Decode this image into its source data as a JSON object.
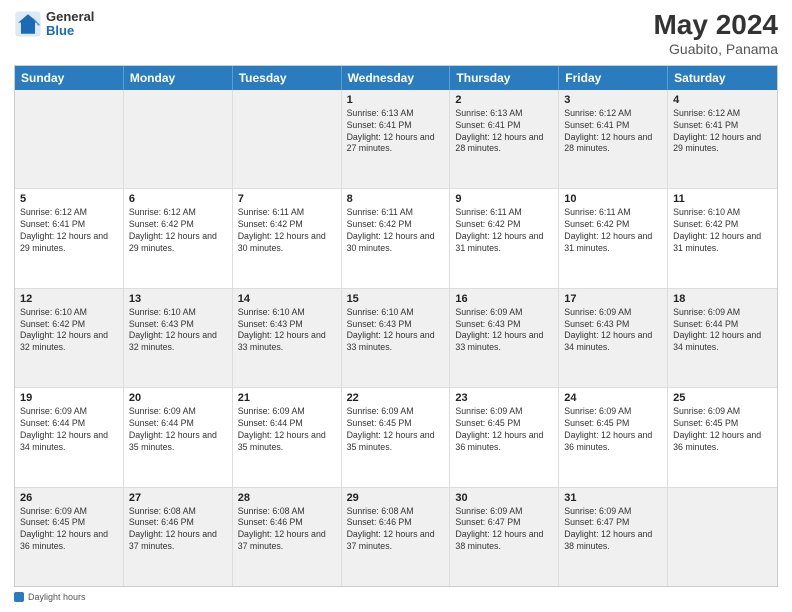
{
  "header": {
    "logo_general": "General",
    "logo_blue": "Blue",
    "title": "May 2024",
    "location": "Guabito, Panama"
  },
  "days_of_week": [
    "Sunday",
    "Monday",
    "Tuesday",
    "Wednesday",
    "Thursday",
    "Friday",
    "Saturday"
  ],
  "weeks": [
    [
      {
        "day": "",
        "empty": true
      },
      {
        "day": "",
        "empty": true
      },
      {
        "day": "",
        "empty": true
      },
      {
        "day": "1",
        "sunrise": "6:13 AM",
        "sunset": "6:41 PM",
        "daylight": "12 hours and 27 minutes."
      },
      {
        "day": "2",
        "sunrise": "6:13 AM",
        "sunset": "6:41 PM",
        "daylight": "12 hours and 28 minutes."
      },
      {
        "day": "3",
        "sunrise": "6:12 AM",
        "sunset": "6:41 PM",
        "daylight": "12 hours and 28 minutes."
      },
      {
        "day": "4",
        "sunrise": "6:12 AM",
        "sunset": "6:41 PM",
        "daylight": "12 hours and 29 minutes."
      }
    ],
    [
      {
        "day": "5",
        "sunrise": "6:12 AM",
        "sunset": "6:41 PM",
        "daylight": "12 hours and 29 minutes."
      },
      {
        "day": "6",
        "sunrise": "6:12 AM",
        "sunset": "6:42 PM",
        "daylight": "12 hours and 29 minutes."
      },
      {
        "day": "7",
        "sunrise": "6:11 AM",
        "sunset": "6:42 PM",
        "daylight": "12 hours and 30 minutes."
      },
      {
        "day": "8",
        "sunrise": "6:11 AM",
        "sunset": "6:42 PM",
        "daylight": "12 hours and 30 minutes."
      },
      {
        "day": "9",
        "sunrise": "6:11 AM",
        "sunset": "6:42 PM",
        "daylight": "12 hours and 31 minutes."
      },
      {
        "day": "10",
        "sunrise": "6:11 AM",
        "sunset": "6:42 PM",
        "daylight": "12 hours and 31 minutes."
      },
      {
        "day": "11",
        "sunrise": "6:10 AM",
        "sunset": "6:42 PM",
        "daylight": "12 hours and 31 minutes."
      }
    ],
    [
      {
        "day": "12",
        "sunrise": "6:10 AM",
        "sunset": "6:42 PM",
        "daylight": "12 hours and 32 minutes."
      },
      {
        "day": "13",
        "sunrise": "6:10 AM",
        "sunset": "6:43 PM",
        "daylight": "12 hours and 32 minutes."
      },
      {
        "day": "14",
        "sunrise": "6:10 AM",
        "sunset": "6:43 PM",
        "daylight": "12 hours and 33 minutes."
      },
      {
        "day": "15",
        "sunrise": "6:10 AM",
        "sunset": "6:43 PM",
        "daylight": "12 hours and 33 minutes."
      },
      {
        "day": "16",
        "sunrise": "6:09 AM",
        "sunset": "6:43 PM",
        "daylight": "12 hours and 33 minutes."
      },
      {
        "day": "17",
        "sunrise": "6:09 AM",
        "sunset": "6:43 PM",
        "daylight": "12 hours and 34 minutes."
      },
      {
        "day": "18",
        "sunrise": "6:09 AM",
        "sunset": "6:44 PM",
        "daylight": "12 hours and 34 minutes."
      }
    ],
    [
      {
        "day": "19",
        "sunrise": "6:09 AM",
        "sunset": "6:44 PM",
        "daylight": "12 hours and 34 minutes."
      },
      {
        "day": "20",
        "sunrise": "6:09 AM",
        "sunset": "6:44 PM",
        "daylight": "12 hours and 35 minutes."
      },
      {
        "day": "21",
        "sunrise": "6:09 AM",
        "sunset": "6:44 PM",
        "daylight": "12 hours and 35 minutes."
      },
      {
        "day": "22",
        "sunrise": "6:09 AM",
        "sunset": "6:45 PM",
        "daylight": "12 hours and 35 minutes."
      },
      {
        "day": "23",
        "sunrise": "6:09 AM",
        "sunset": "6:45 PM",
        "daylight": "12 hours and 36 minutes."
      },
      {
        "day": "24",
        "sunrise": "6:09 AM",
        "sunset": "6:45 PM",
        "daylight": "12 hours and 36 minutes."
      },
      {
        "day": "25",
        "sunrise": "6:09 AM",
        "sunset": "6:45 PM",
        "daylight": "12 hours and 36 minutes."
      }
    ],
    [
      {
        "day": "26",
        "sunrise": "6:09 AM",
        "sunset": "6:45 PM",
        "daylight": "12 hours and 36 minutes."
      },
      {
        "day": "27",
        "sunrise": "6:08 AM",
        "sunset": "6:46 PM",
        "daylight": "12 hours and 37 minutes."
      },
      {
        "day": "28",
        "sunrise": "6:08 AM",
        "sunset": "6:46 PM",
        "daylight": "12 hours and 37 minutes."
      },
      {
        "day": "29",
        "sunrise": "6:08 AM",
        "sunset": "6:46 PM",
        "daylight": "12 hours and 37 minutes."
      },
      {
        "day": "30",
        "sunrise": "6:09 AM",
        "sunset": "6:47 PM",
        "daylight": "12 hours and 38 minutes."
      },
      {
        "day": "31",
        "sunrise": "6:09 AM",
        "sunset": "6:47 PM",
        "daylight": "12 hours and 38 minutes."
      },
      {
        "day": "",
        "empty": true
      }
    ]
  ],
  "footer": {
    "label": "Daylight hours"
  }
}
